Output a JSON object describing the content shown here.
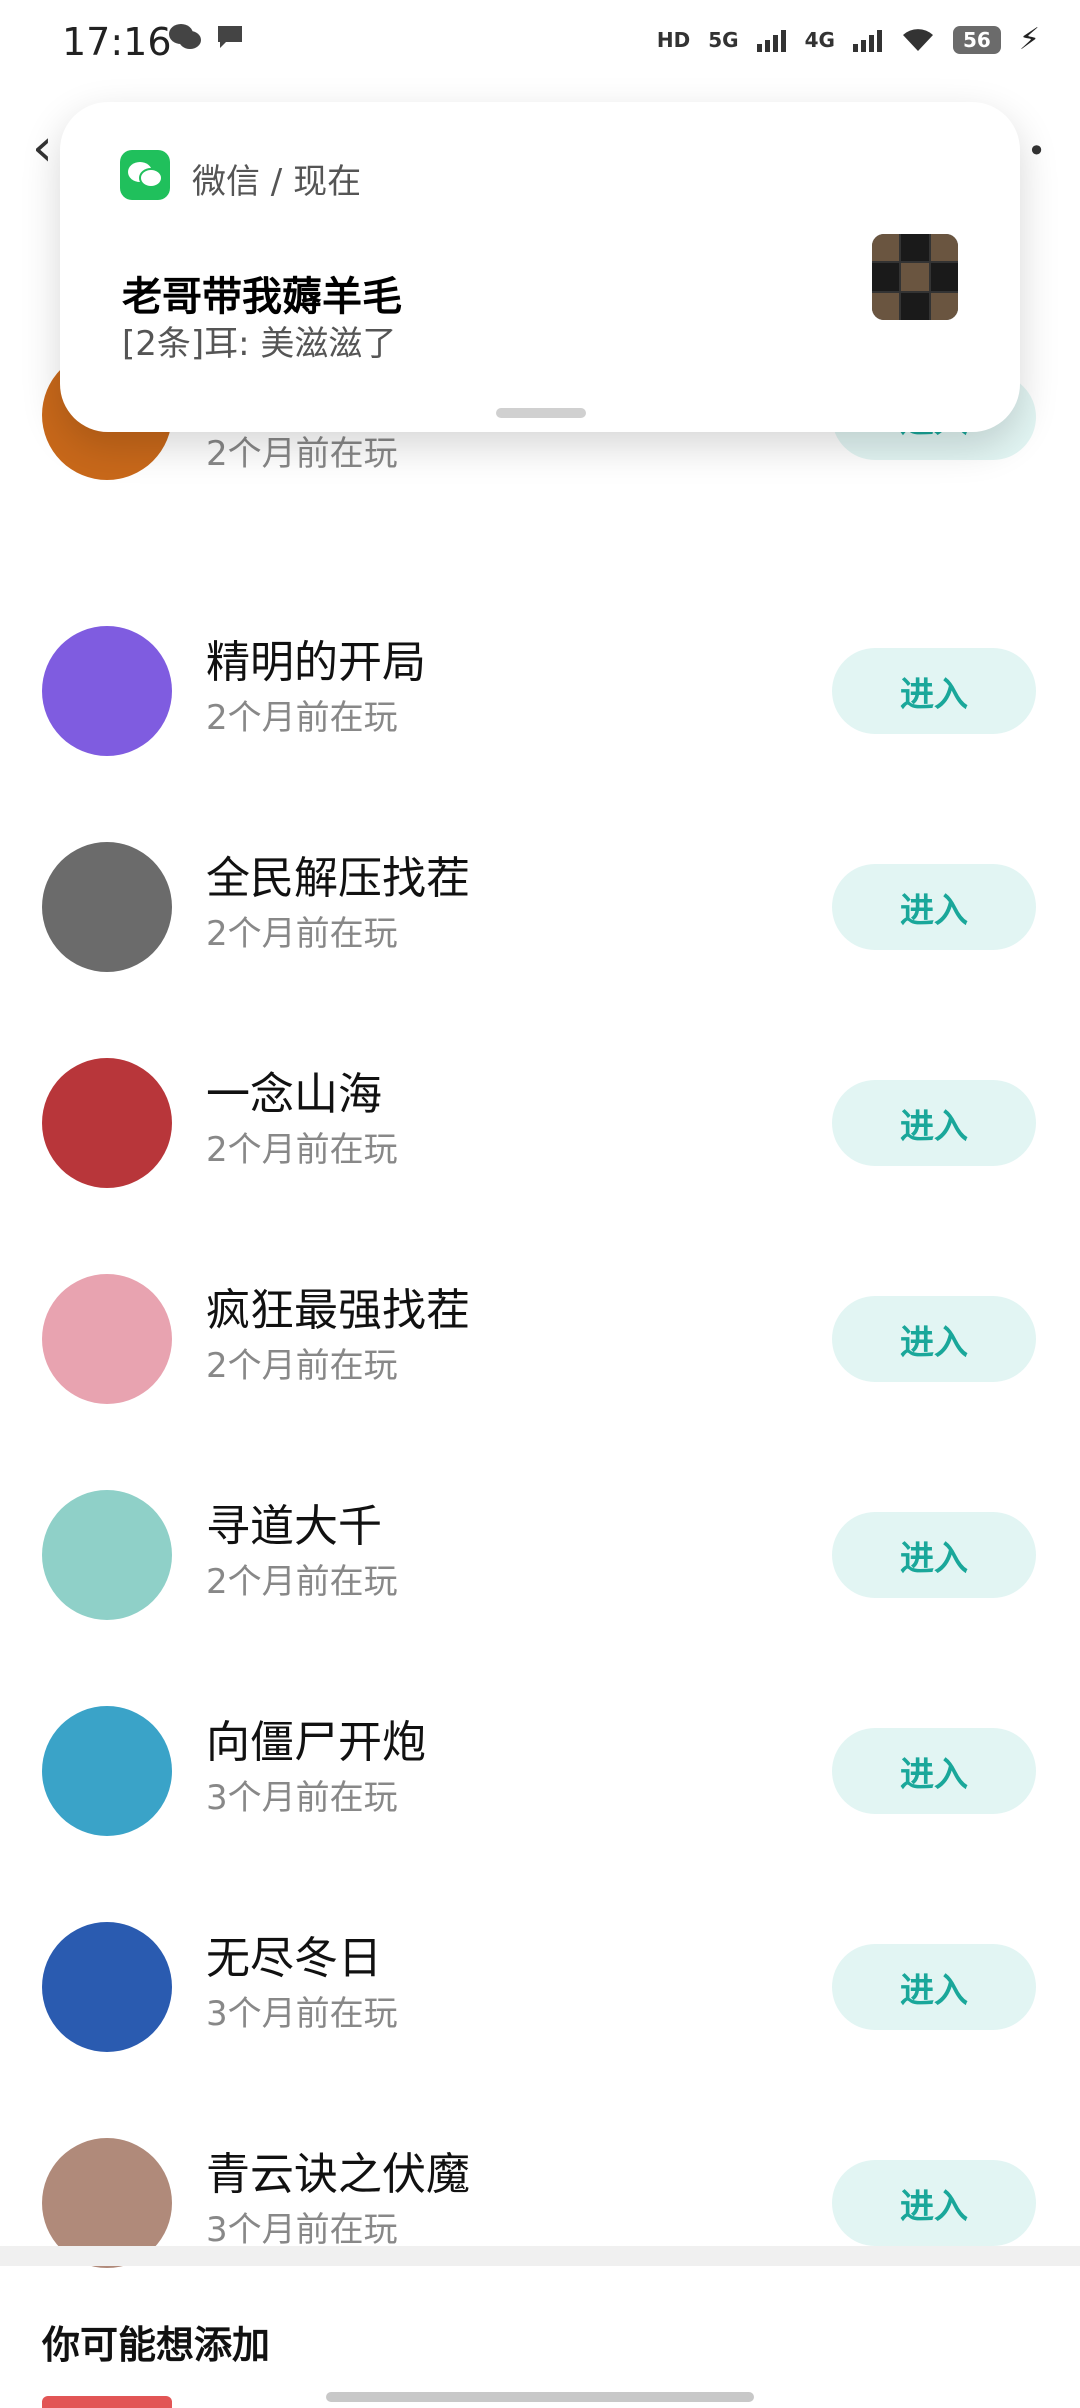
{
  "status_bar": {
    "time": "17:16",
    "left_icons": [
      "wechat-icon",
      "chat-bubble-icon"
    ],
    "right_icons": [
      "hd-icon",
      "5g-signal-icon",
      "4g-signal-icon",
      "wifi-icon",
      "battery-icon",
      "charging-icon"
    ],
    "hd_label": "HD",
    "fiveg_label": "5G",
    "fourg_label": "4G",
    "battery_level": "56"
  },
  "notification": {
    "app_name": "微信 / 现在",
    "title": "老哥带我薅羊毛",
    "body": "[2条]耳: 美滋滋了",
    "app_icon": "wechat-icon",
    "thumbnail_icon": "group-avatar-grid-icon"
  },
  "games": [
    {
      "name": "",
      "time": "2个月前在玩",
      "button": "进入",
      "avatar_color": "#c8681a"
    },
    {
      "name": "精明的开局",
      "time": "2个月前在玩",
      "button": "进入",
      "avatar_color": "#7f5ce0"
    },
    {
      "name": "全民解压找茬",
      "time": "2个月前在玩",
      "button": "进入",
      "avatar_color": "#6b6b6b"
    },
    {
      "name": "一念山海",
      "time": "2个月前在玩",
      "button": "进入",
      "avatar_color": "#b8363a"
    },
    {
      "name": "疯狂最强找茬",
      "time": "2个月前在玩",
      "button": "进入",
      "avatar_color": "#e8a3b0"
    },
    {
      "name": "寻道大千",
      "time": "2个月前在玩",
      "button": "进入",
      "avatar_color": "#8fd0c8"
    },
    {
      "name": "向僵尸开炮",
      "time": "3个月前在玩",
      "button": "进入",
      "avatar_color": "#3aa3c8"
    },
    {
      "name": "无尽冬日",
      "time": "3个月前在玩",
      "button": "进入",
      "avatar_color": "#2a5bb0"
    },
    {
      "name": "青云诀之伏魔",
      "time": "3个月前在玩",
      "button": "进入",
      "avatar_color": "#b08a7a"
    }
  ],
  "section": {
    "title": "你可能想添加"
  }
}
